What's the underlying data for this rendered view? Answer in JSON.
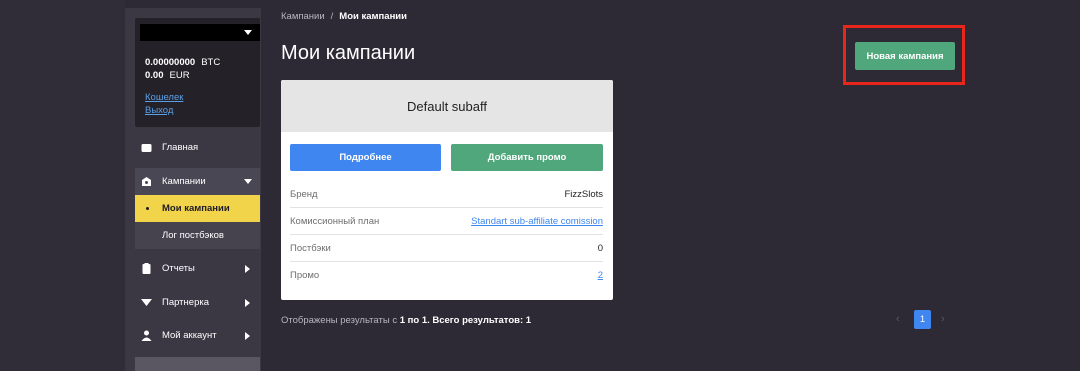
{
  "sidebar": {
    "balances": [
      {
        "amount": "0.00000000",
        "currency": "BTC"
      },
      {
        "amount": "0.00",
        "currency": "EUR"
      }
    ],
    "wallet_link": "Кошелек",
    "logout_link": "Выход",
    "nav": {
      "home": "Главная",
      "campaigns": "Кампании",
      "my_campaigns": "Мои кампании",
      "postback_log": "Лог постбэков",
      "reports": "Отчеты",
      "partner": "Партнерка",
      "account": "Мой аккаунт"
    }
  },
  "breadcrumb": {
    "parent": "Кампании",
    "separator": "/",
    "current": "Мои кампании"
  },
  "page_title": "Мои кампании",
  "new_campaign_button": "Новая кампания",
  "card": {
    "title": "Default subaff",
    "details_button": "Подробнее",
    "add_promo_button": "Добавить промо",
    "rows": [
      {
        "key": "Бренд",
        "value": "FizzSlots"
      },
      {
        "key": "Комиссионный план",
        "value": "Standart sub-affiliate comission"
      },
      {
        "key": "Постбэки",
        "value": "0"
      },
      {
        "key": "Промо",
        "value": "2"
      }
    ]
  },
  "results": {
    "prefix": "Отображены результаты с",
    "range": "1 по 1. Всего результатов: 1"
  },
  "pagination": {
    "prev": "‹",
    "current": "1",
    "next": "›"
  },
  "colors": {
    "accent_green": "#4fa77b",
    "accent_blue": "#3f86f0",
    "active_yellow": "#f2d44a",
    "highlight_red": "#e8261b"
  }
}
